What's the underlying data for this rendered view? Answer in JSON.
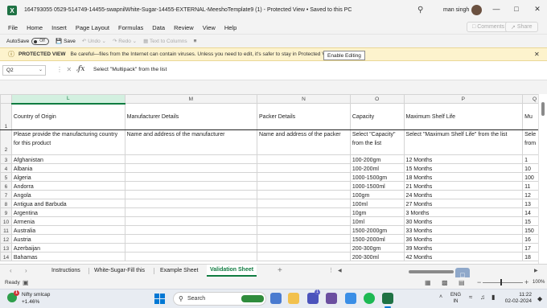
{
  "window": {
    "app_logo": "X",
    "title": "164793055 0529-514749-14455-swapnilWhite-Sugar-14455-EXTERNAL-MeeshoTemplate9 (1)  -  Protected View • Saved to this PC",
    "user_name": "man singh"
  },
  "menu": {
    "items": [
      "File",
      "Home",
      "Insert",
      "Page Layout",
      "Formulas",
      "Data",
      "Review",
      "View",
      "Help"
    ],
    "comments_label": "Comments",
    "share_label": "Share"
  },
  "toolbar": {
    "autosave_label": "AutoSave",
    "autosave_state": "Off",
    "save_label": "Save",
    "undo_label": "Undo",
    "redo_label": "Redo",
    "text_to_columns_label": "Text to Columns"
  },
  "protected_view": {
    "heading": "PROTECTED VIEW",
    "message": "Be careful—files from the Internet can contain viruses. Unless you need to edit, it's safer to stay in Protected View.",
    "button_label": "Enable Editing"
  },
  "formula_bar": {
    "cell_ref": "Q2",
    "fx": "fx",
    "formula": "Select \"Multipack\" from the list"
  },
  "sheet": {
    "columns": [
      "L",
      "M",
      "N",
      "O",
      "P",
      "Q"
    ],
    "selected_column": "L",
    "header_row": [
      "Country of Origin",
      "Manufacturer Details",
      "Packer Details",
      "Capacity",
      "Maximum Shelf Life",
      "Mu"
    ],
    "instruction_row": [
      "Please provide the manufacturing country for this product",
      "Name and address of the manufacturer",
      "Name and address of the packer",
      "Select \"Capacity\" from the list",
      "Select \"Maximum Shelf Life\" from the list",
      "Sele from"
    ],
    "rows": [
      {
        "num": "3",
        "country": "Afghanistan",
        "capacity": "100-200gm",
        "shelf": "12 Months",
        "q": "1"
      },
      {
        "num": "4",
        "country": "Albania",
        "capacity": "100-200ml",
        "shelf": "15 Months",
        "q": "10"
      },
      {
        "num": "5",
        "country": "Algeria",
        "capacity": "1000-1500gm",
        "shelf": "18 Months",
        "q": "100"
      },
      {
        "num": "6",
        "country": "Andorra",
        "capacity": "1000-1500ml",
        "shelf": "21 Months",
        "q": "11"
      },
      {
        "num": "7",
        "country": "Angola",
        "capacity": "100gm",
        "shelf": "24 Months",
        "q": "12"
      },
      {
        "num": "8",
        "country": "Antigua and Barbuda",
        "capacity": "100ml",
        "shelf": "27 Months",
        "q": "13"
      },
      {
        "num": "9",
        "country": "Argentina",
        "capacity": "10gm",
        "shelf": "3 Months",
        "q": "14"
      },
      {
        "num": "10",
        "country": "Armenia",
        "capacity": "10ml",
        "shelf": "30 Months",
        "q": "15"
      },
      {
        "num": "11",
        "country": "Australia",
        "capacity": "1500-2000gm",
        "shelf": "33 Months",
        "q": "150"
      },
      {
        "num": "12",
        "country": "Austria",
        "capacity": "1500-2000ml",
        "shelf": "36 Months",
        "q": "16"
      },
      {
        "num": "13",
        "country": "Azerbaijan",
        "capacity": "200-300gm",
        "shelf": "39 Months",
        "q": "17"
      },
      {
        "num": "14",
        "country": "Bahamas",
        "capacity": "200-300ml",
        "shelf": "42 Months",
        "q": "18"
      }
    ]
  },
  "tabs": {
    "items": [
      "Instructions",
      "White-Sugar-Fill this",
      "Example Sheet",
      "Validation Sheet"
    ],
    "active": "Validation Sheet",
    "add_label": "+"
  },
  "status": {
    "ready": "Ready",
    "zoom": "100%"
  },
  "taskbar": {
    "widget_name": "Nifty smlcap",
    "widget_value": "+1.46%",
    "widget_badge": "1",
    "search_label": "Search",
    "teams_badge": "1",
    "lang_top": "ENG",
    "lang_bottom": "IN",
    "time": "11:22",
    "date": "02-02-2024"
  },
  "colors": {
    "excel_green": "#107c41",
    "warning_bg": "#fdf3cd",
    "accent_blue": "#0078d4"
  }
}
